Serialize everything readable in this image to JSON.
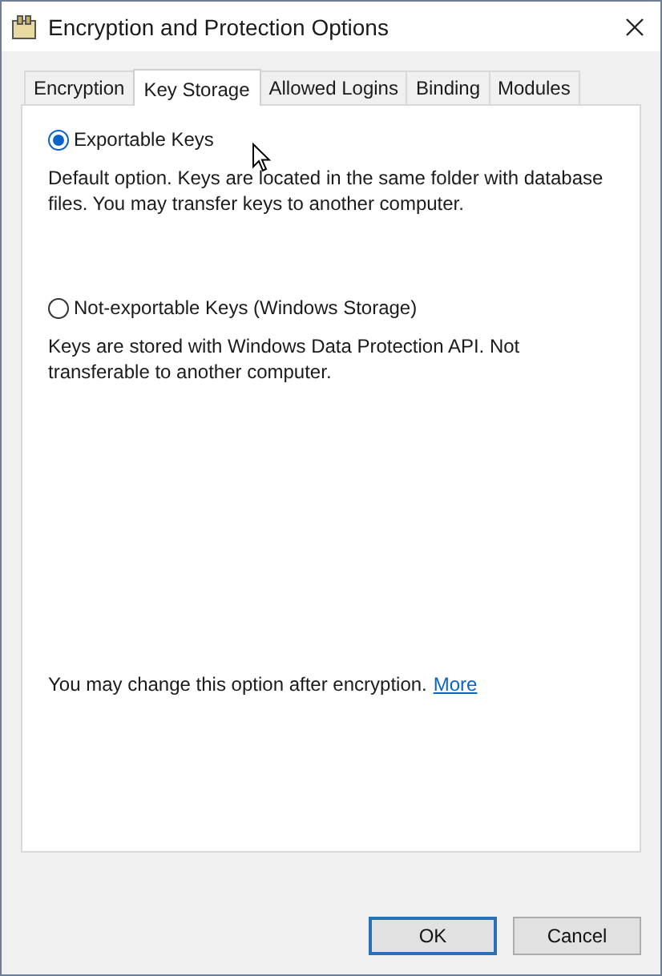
{
  "window": {
    "title": "Encryption and Protection Options"
  },
  "tabs": [
    {
      "label": "Encryption",
      "selected": false
    },
    {
      "label": "Key Storage",
      "selected": true
    },
    {
      "label": "Allowed Logins",
      "selected": false
    },
    {
      "label": "Binding",
      "selected": false
    },
    {
      "label": "Modules",
      "selected": false
    }
  ],
  "options": [
    {
      "label": "Exportable Keys",
      "selected": true,
      "description": "Default option. Keys are located in the same folder with database files. You may transfer keys to another computer."
    },
    {
      "label": "Not-exportable Keys (Windows Storage)",
      "selected": false,
      "description": "Keys are stored with Windows Data Protection API. Not transferable to another computer."
    }
  ],
  "note": {
    "text": "You may change this option after encryption.",
    "link": "More"
  },
  "buttons": [
    {
      "label": "OK",
      "kind": "default"
    },
    {
      "label": "Cancel",
      "kind": "normal"
    }
  ]
}
